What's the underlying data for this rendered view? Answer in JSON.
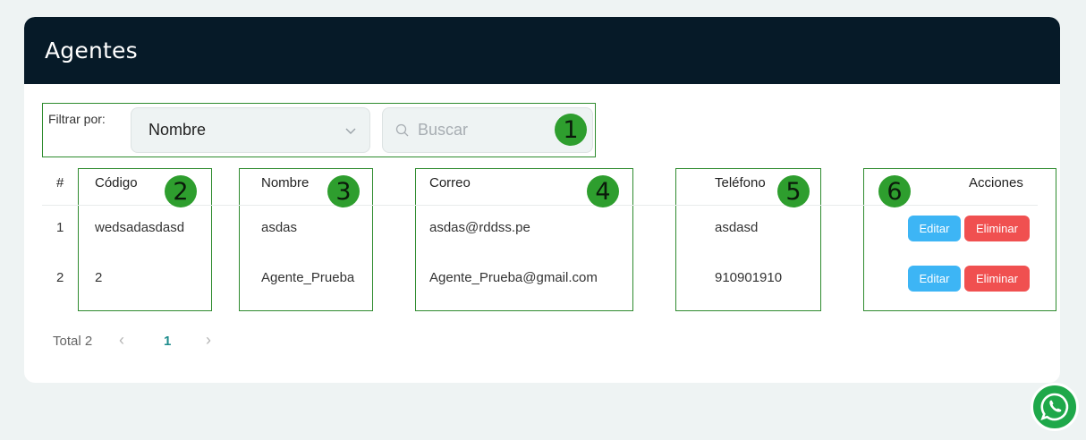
{
  "page": {
    "title": "Agentes"
  },
  "filter": {
    "label": "Filtrar por:",
    "select_value": "Nombre",
    "search_placeholder": "Buscar"
  },
  "markers": [
    "1",
    "2",
    "3",
    "4",
    "5",
    "6"
  ],
  "table": {
    "headers": {
      "index": "#",
      "code": "Código",
      "name": "Nombre",
      "email": "Correo",
      "phone": "Teléfono",
      "actions": "Acciones"
    },
    "rows": [
      {
        "index": "1",
        "code": "wedsadasdasd",
        "name": "asdas",
        "email": "asdas@rddss.pe",
        "phone": "asdasd"
      },
      {
        "index": "2",
        "code": "2",
        "name": "Agente_Prueba",
        "email": "Agente_Prueba@gmail.com",
        "phone": "910901910"
      }
    ],
    "actions": {
      "edit": "Editar",
      "delete": "Eliminar"
    }
  },
  "pagination": {
    "total": "Total 2",
    "current_page": "1",
    "prev": "‹",
    "next": "›"
  },
  "colors": {
    "header_bg": "#061a28",
    "edit": "#3db5f5",
    "delete": "#f05050",
    "annotation": "#2e8b2e",
    "whatsapp": "#1fa84a"
  },
  "icons": {
    "select": "chevron-down-icon",
    "search": "search-icon",
    "fab": "whatsapp-icon"
  }
}
